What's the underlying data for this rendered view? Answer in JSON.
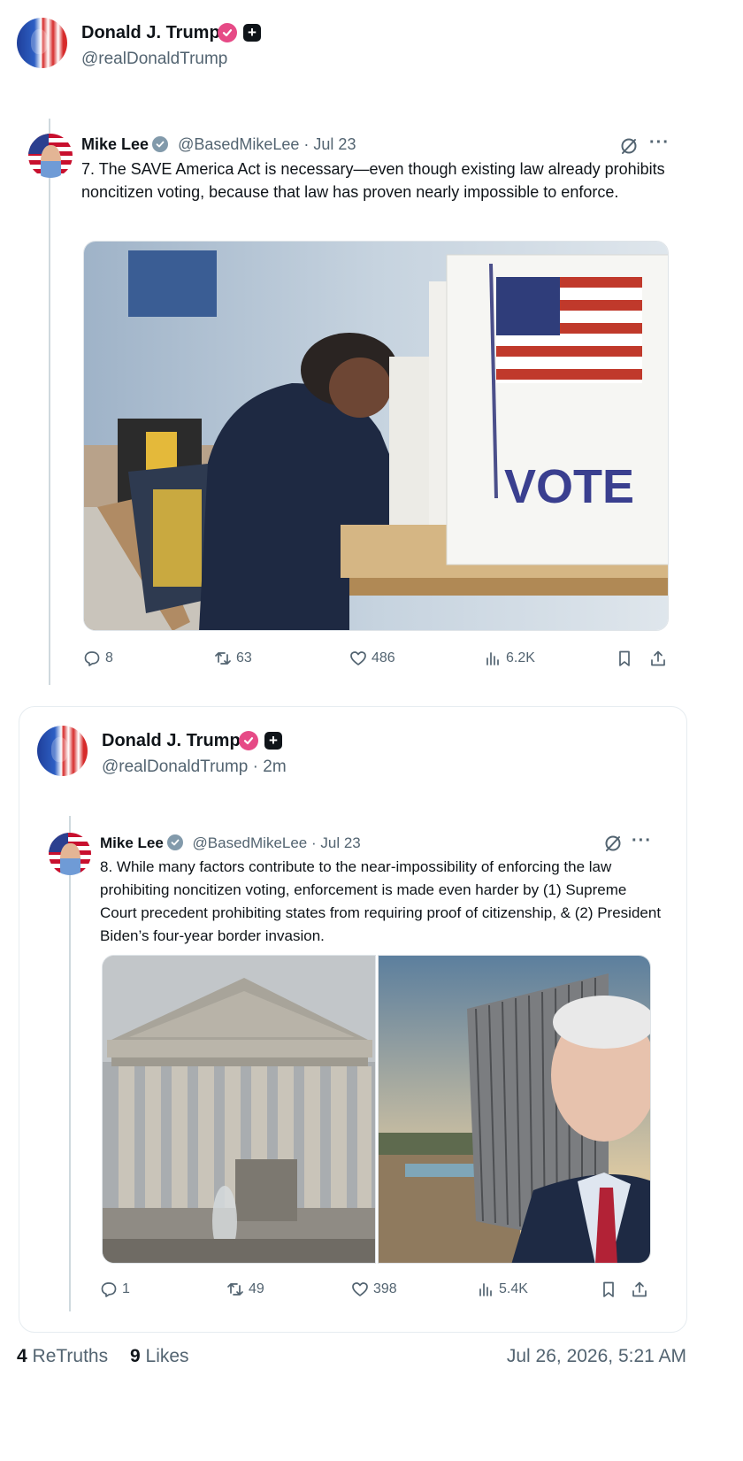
{
  "top_post": {
    "author_name": "Donald J. Trump",
    "author_handle": "@realDonaldTrump"
  },
  "quote1": {
    "author_name": "Mike Lee",
    "author_handle": "@BasedMikeLee",
    "date": "Jul 23",
    "text": "7. The SAVE America Act is necessary—even though existing law already prohibits noncitizen voting, because that law has proven nearly impossible to enforce.",
    "image_sign_text": "VOTE",
    "stats": {
      "replies": "8",
      "retruths": "63",
      "likes": "486",
      "views": "6.2K"
    }
  },
  "second_post": {
    "author_name": "Donald J. Trump",
    "author_handle": "@realDonaldTrump",
    "time_ago": "2m"
  },
  "quote2": {
    "author_name": "Mike Lee",
    "author_handle": "@BasedMikeLee",
    "date": "Jul 23",
    "text": "8. While many factors contribute to the near-impossibility of enforcing the law prohibiting noncitizen voting, enforcement is made even harder by (1) Supreme Court precedent prohibiting states from requiring proof of citizenship, & (2) President Biden’s four-year border invasion.",
    "stats": {
      "replies": "1",
      "retruths": "49",
      "likes": "398",
      "views": "5.4K"
    }
  },
  "footer": {
    "retruth_count": "4",
    "retruth_label": "ReTruths",
    "like_count": "9",
    "like_label": "Likes",
    "timestamp": "Jul 26, 2026, 5:21 AM"
  },
  "icons": {
    "verified": "verified-badge-icon",
    "plus": "plus-badge-icon",
    "grok": "grok-icon",
    "reply": "reply-icon",
    "repost": "repost-icon",
    "like": "heart-icon",
    "views": "views-icon",
    "bookmark": "bookmark-icon",
    "share": "share-icon"
  },
  "colors": {
    "verified_pink": "#e64a86",
    "verified_gray": "#829aab",
    "secondary_text": "#536471"
  }
}
